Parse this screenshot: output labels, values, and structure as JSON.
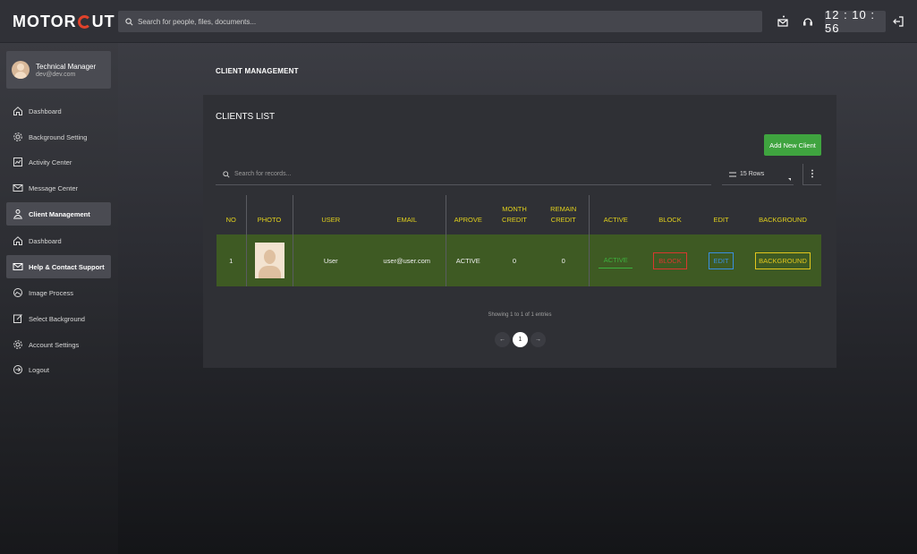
{
  "brand": {
    "name_left": "MOTOR",
    "name_right": "UT"
  },
  "header": {
    "search_placeholder": "Search for people, files, documents...",
    "clock": "12 : 10 : 56"
  },
  "profile": {
    "name": "Technical Manager",
    "email": "dev@dev.com"
  },
  "sidebar": {
    "items": [
      {
        "label": "Dashboard",
        "icon": "home-icon"
      },
      {
        "label": "Background Setting",
        "icon": "gear-icon"
      },
      {
        "label": "Activity Center",
        "icon": "activity-icon"
      },
      {
        "label": "Message Center",
        "icon": "mail-icon"
      },
      {
        "label": "Client Management",
        "icon": "users-icon"
      },
      {
        "label": "Dashboard",
        "icon": "home-icon"
      },
      {
        "label": "Help & Contact Support",
        "icon": "mail-icon"
      },
      {
        "label": "Image Process",
        "icon": "image-icon"
      },
      {
        "label": "Select Background",
        "icon": "edit-icon"
      },
      {
        "label": "Account Settings",
        "icon": "gear-icon"
      },
      {
        "label": "Logout",
        "icon": "logout-icon"
      }
    ]
  },
  "main": {
    "page_title": "CLIENT MANAGEMENT",
    "panel_title": "CLIENTS LIST",
    "add_button": "Add New Client",
    "search_placeholder": "Search for records...",
    "rows_select": "15 Rows",
    "table": {
      "headers": {
        "no": "NO",
        "photo": "PHOTO",
        "user": "USER",
        "email": "EMAIL",
        "aprove": "APROVE",
        "month_credit_1": "MONTH",
        "month_credit_2": "CREDIT",
        "remain_credit_1": "REMAIN",
        "remain_credit_2": "CREDIT",
        "active": "ACTIVE",
        "block": "BLOCK",
        "edit": "EDIT",
        "background": "BACKGROUND"
      },
      "rows": [
        {
          "no": "1",
          "user": "User",
          "email": "user@user.com",
          "aprove": "ACTIVE",
          "month_credit": "0",
          "remain_credit": "0",
          "active_btn": "ACTIVE",
          "block_btn": "BLOCK",
          "edit_btn": "EDIT",
          "background_btn": "BACKGROUND"
        }
      ]
    },
    "showing_text": "Showing 1 to 1 of 1 entries",
    "pagination": {
      "prev": "←",
      "current": "1",
      "next": "→"
    }
  },
  "colors": {
    "accent_green": "#3fa43f",
    "header_yellow": "#e3d21c",
    "row_green": "#3e5a23",
    "block_red": "#d9372e",
    "edit_blue": "#3a8fe0"
  }
}
